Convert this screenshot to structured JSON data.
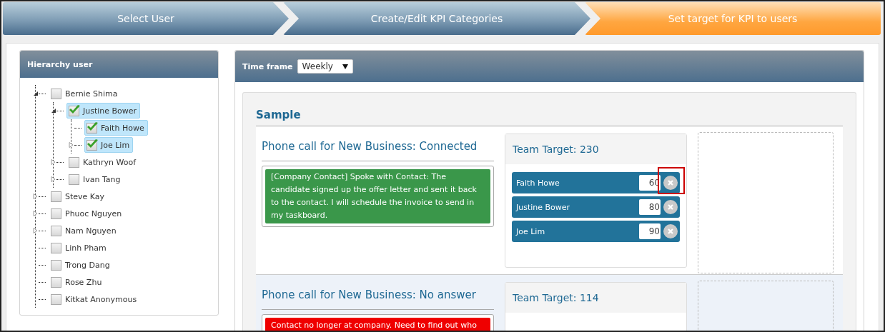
{
  "steps": [
    {
      "label": "Select User",
      "selected": false
    },
    {
      "label": "Create/Edit KPI Categories",
      "selected": false
    },
    {
      "label": "Set target for KPI to users",
      "selected": true
    }
  ],
  "hierarchy": {
    "title": "Hierarchy user",
    "tree": [
      {
        "name": "Bernie Shima",
        "kind": "expanded",
        "checked": false,
        "selected": false,
        "children": [
          {
            "name": "Justine Bower",
            "kind": "expanded",
            "checked": true,
            "selected": true,
            "children": [
              {
                "name": "Faith Howe",
                "kind": "leaf",
                "checked": true,
                "selected": true
              },
              {
                "name": "Joe Lim",
                "kind": "collapsed",
                "checked": true,
                "selected": true
              }
            ]
          },
          {
            "name": "Kathryn Woof",
            "kind": "collapsed",
            "checked": false,
            "selected": false
          },
          {
            "name": "Ivan Tang",
            "kind": "collapsed",
            "checked": false,
            "selected": false
          }
        ]
      },
      {
        "name": "Steve Kay",
        "kind": "collapsed",
        "checked": false,
        "selected": false
      },
      {
        "name": "Phuoc Nguyen",
        "kind": "collapsed",
        "checked": false,
        "selected": false
      },
      {
        "name": "Nam Nguyen",
        "kind": "collapsed",
        "checked": false,
        "selected": false
      },
      {
        "name": "Linh Pham",
        "kind": "leaf",
        "checked": false,
        "selected": false
      },
      {
        "name": "Trong Dang",
        "kind": "leaf",
        "checked": false,
        "selected": false
      },
      {
        "name": "Rose Zhu",
        "kind": "leaf",
        "checked": false,
        "selected": false
      },
      {
        "name": "Kitkat Anonymous",
        "kind": "leaf",
        "checked": false,
        "selected": false
      }
    ]
  },
  "targets": {
    "time_frame": {
      "label": "Time frame",
      "value": "Weekly"
    },
    "section_title": "Sample",
    "kpis": [
      {
        "title": "Phone call for New Business: Connected",
        "message": {
          "kind": "success",
          "text": "[Company Contact] Spoke with Contact: The candidate signed up the offer letter and sent it back to the contact. I will schedule the invoice to send in my taskboard."
        },
        "team_target": "Team Target: 230",
        "members": [
          {
            "name": "Faith Howe",
            "value": "60",
            "highlighted": true
          },
          {
            "name": "Justine Bower",
            "value": "80",
            "highlighted": false
          },
          {
            "name": "Joe Lim",
            "value": "90",
            "highlighted": false
          }
        ]
      },
      {
        "title": "Phone call for New Business: No answer",
        "message": {
          "kind": "error",
          "text": "Contact no longer at company. Need to find out who"
        },
        "team_target": "Team Target: 114"
      }
    ]
  }
}
